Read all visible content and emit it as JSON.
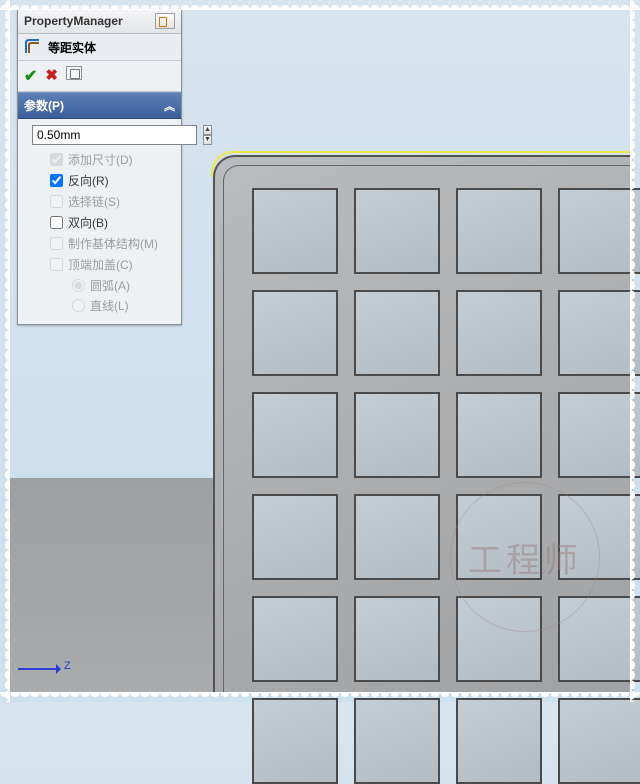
{
  "pm": {
    "title": "PropertyManager"
  },
  "feature": {
    "name": "等距实体"
  },
  "group": {
    "title": "参数(P)",
    "expanded": true
  },
  "params": {
    "distance": "0.50mm",
    "add_dim": {
      "label": "添加尺寸(D)",
      "checked": true,
      "enabled": false
    },
    "reverse": {
      "label": "反向(R)",
      "checked": true,
      "enabled": true
    },
    "chain": {
      "label": "选择链(S)",
      "checked": false,
      "enabled": false
    },
    "bidir": {
      "label": "双向(B)",
      "checked": false,
      "enabled": true
    },
    "base": {
      "label": "制作基体结构(M)",
      "checked": false,
      "enabled": false
    },
    "cap": {
      "label": "顶端加盖(C)",
      "checked": false,
      "enabled": false
    },
    "cap_arc": {
      "label": "圆弧(A)",
      "selected": true
    },
    "cap_line": {
      "label": "直线(L)",
      "selected": false
    }
  },
  "axis": {
    "label": "Z"
  },
  "watermark": {
    "text": "工程师"
  }
}
